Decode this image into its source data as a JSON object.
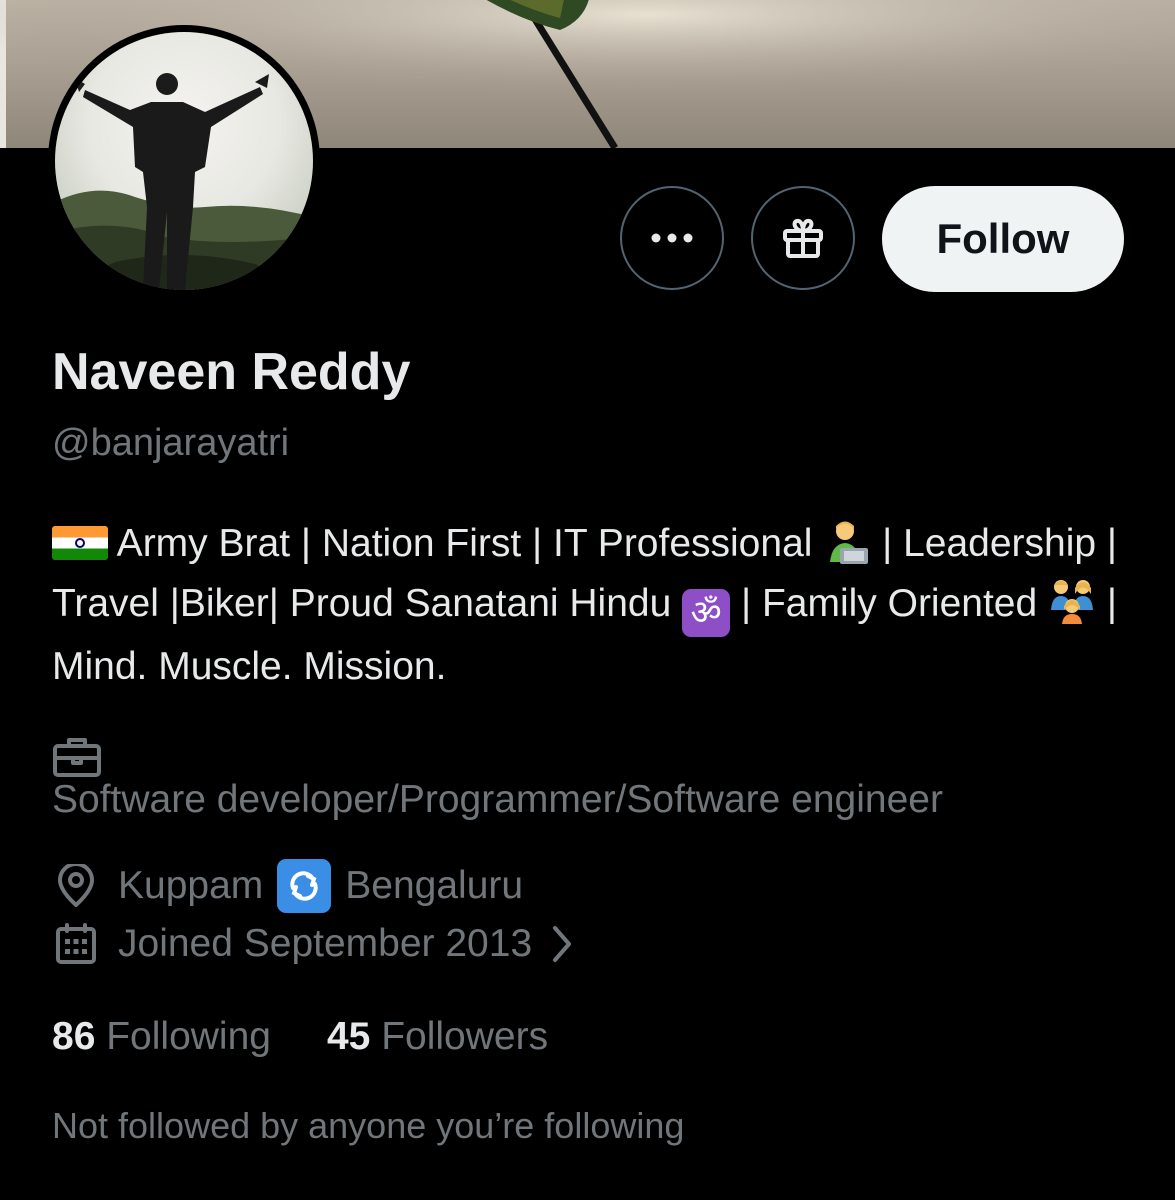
{
  "profile": {
    "name": "Naveen Reddy",
    "handle": "@banjarayatri",
    "follow_label": "Follow",
    "bio": {
      "part1": " Army Brat | Nation First | IT Professional ",
      "part2": " | Leadership | Travel |Biker| Proud Sanatani Hindu ",
      "om_glyph": "ॐ",
      "part3": " | Family Oriented ",
      "part4": " | Mind. Muscle. Mission."
    },
    "profession": "Software developer/Programmer/Software engineer",
    "location_from": "Kuppam",
    "location_to": "Bengaluru",
    "joined": "Joined September 2013",
    "following_count": "86",
    "following_label": "Following",
    "followers_count": "45",
    "followers_label": "Followers",
    "mutual_text": "Not followed by anyone you’re following"
  },
  "icons": {
    "more": "more-icon",
    "gift": "gift-icon",
    "briefcase": "briefcase-icon",
    "location": "location-pin-icon",
    "calendar": "calendar-icon",
    "chevron": "chevron-right-icon",
    "flag": "india-flag-icon",
    "technologist": "technologist-emoji-icon",
    "om": "om-emoji-icon",
    "family": "family-emoji-icon",
    "swap": "repeat-arrows-emoji-icon"
  },
  "colors": {
    "background": "#000000",
    "primary_text": "#e7e9ea",
    "secondary_text": "#71767b",
    "button_border": "#536471",
    "follow_bg": "#eff3f4"
  }
}
